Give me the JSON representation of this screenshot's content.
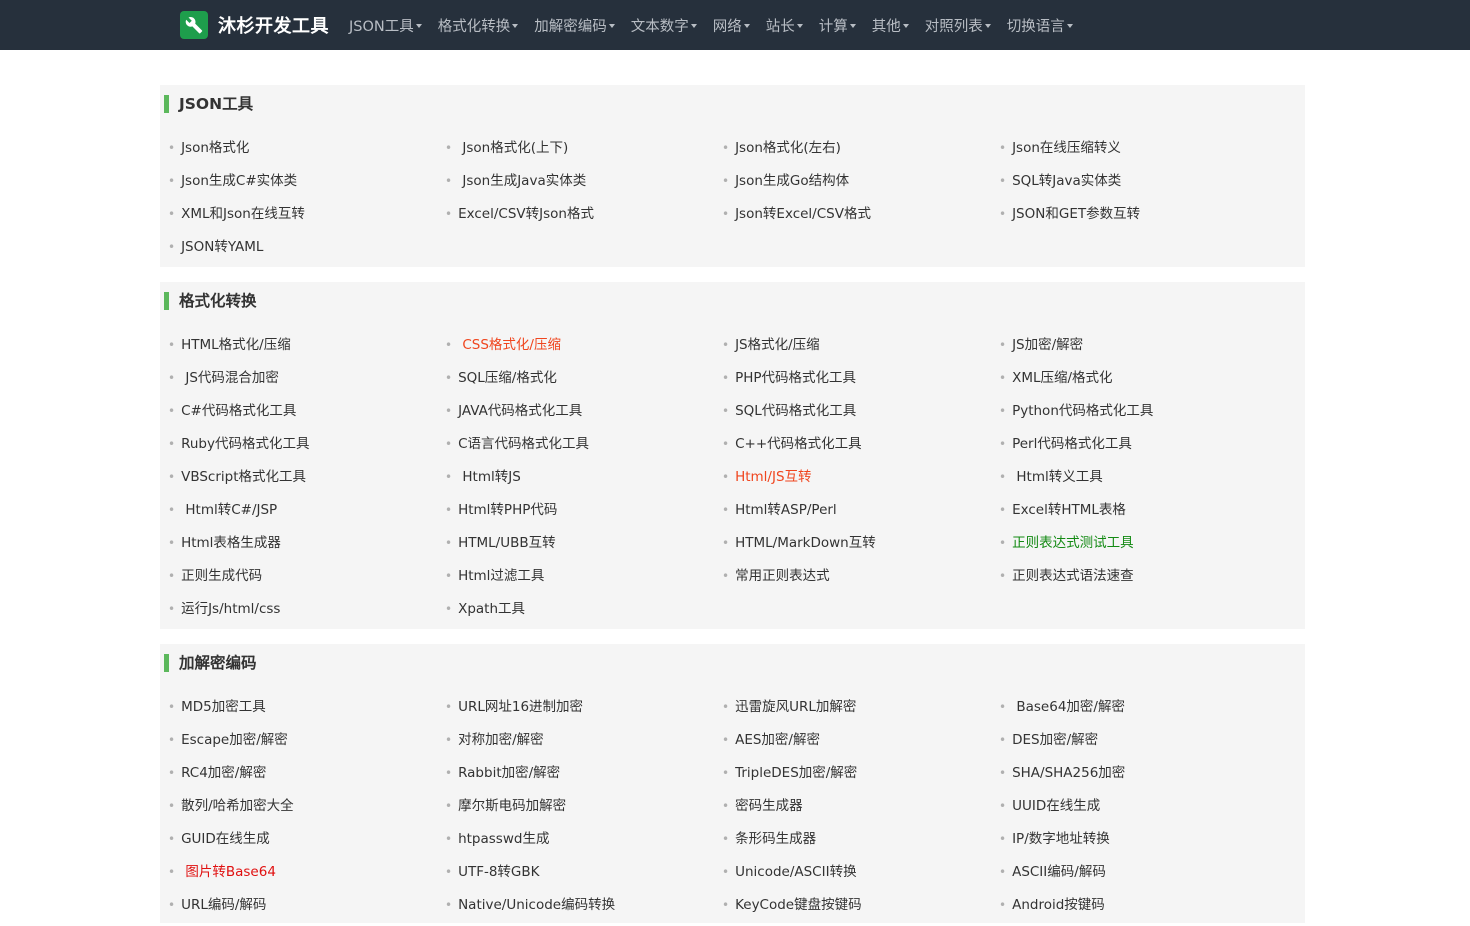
{
  "brand": {
    "name": "沐杉开发工具",
    "icon": "wrench-icon",
    "color": "#1e9e4c"
  },
  "nav": {
    "items": [
      "JSON工具",
      "格式化转换",
      "加解密编码",
      "文本数字",
      "网络",
      "站长",
      "计算",
      "其他",
      "对照列表",
      "切换语言"
    ]
  },
  "colors": {
    "navbar_bg": "#26303c",
    "section_bg": "#f5f5f5",
    "title_accent": "#5cb85c",
    "highlight_orange": "#f0451e",
    "highlight_red": "#e01010",
    "highlight_green": "#138a13"
  },
  "sections": [
    {
      "title": "JSON工具",
      "links": [
        {
          "label": "Json格式化"
        },
        {
          "label": " Json格式化(上下)"
        },
        {
          "label": "Json格式化(左右)"
        },
        {
          "label": "Json在线压缩转义"
        },
        {
          "label": "Json生成C#实体类"
        },
        {
          "label": " Json生成Java实体类"
        },
        {
          "label": "Json生成Go结构体"
        },
        {
          "label": "SQL转Java实体类"
        },
        {
          "label": "XML和Json在线互转"
        },
        {
          "label": "Excel/CSV转Json格式"
        },
        {
          "label": "Json转Excel/CSV格式"
        },
        {
          "label": "JSON和GET参数互转"
        },
        {
          "label": "JSON转YAML"
        }
      ]
    },
    {
      "title": "格式化转换",
      "links": [
        {
          "label": "HTML格式化/压缩"
        },
        {
          "label": " CSS格式化/压缩",
          "highlight": "orange"
        },
        {
          "label": "JS格式化/压缩"
        },
        {
          "label": "JS加密/解密"
        },
        {
          "label": " JS代码混合加密"
        },
        {
          "label": "SQL压缩/格式化"
        },
        {
          "label": "PHP代码格式化工具"
        },
        {
          "label": "XML压缩/格式化"
        },
        {
          "label": "C#代码格式化工具"
        },
        {
          "label": "JAVA代码格式化工具"
        },
        {
          "label": "SQL代码格式化工具"
        },
        {
          "label": "Python代码格式化工具"
        },
        {
          "label": "Ruby代码格式化工具"
        },
        {
          "label": "C语言代码格式化工具"
        },
        {
          "label": "C++代码格式化工具"
        },
        {
          "label": "Perl代码格式化工具"
        },
        {
          "label": "VBScript格式化工具"
        },
        {
          "label": " Html转JS"
        },
        {
          "label": "Html/JS互转",
          "highlight": "orange"
        },
        {
          "label": " Html转义工具"
        },
        {
          "label": " Html转C#/JSP"
        },
        {
          "label": "Html转PHP代码"
        },
        {
          "label": "Html转ASP/Perl"
        },
        {
          "label": "Excel转HTML表格"
        },
        {
          "label": "Html表格生成器"
        },
        {
          "label": "HTML/UBB互转"
        },
        {
          "label": "HTML/MarkDown互转"
        },
        {
          "label": "正则表达式测试工具",
          "highlight": "green"
        },
        {
          "label": "正则生成代码"
        },
        {
          "label": "Html过滤工具"
        },
        {
          "label": "常用正则表达式"
        },
        {
          "label": "正则表达式语法速查"
        },
        {
          "label": "运行Js/html/css"
        },
        {
          "label": "Xpath工具"
        }
      ]
    },
    {
      "title": "加解密编码",
      "links": [
        {
          "label": "MD5加密工具"
        },
        {
          "label": "URL网址16进制加密"
        },
        {
          "label": "迅雷旋风URL加解密"
        },
        {
          "label": " Base64加密/解密"
        },
        {
          "label": "Escape加密/解密"
        },
        {
          "label": "对称加密/解密"
        },
        {
          "label": "AES加密/解密"
        },
        {
          "label": "DES加密/解密"
        },
        {
          "label": "RC4加密/解密"
        },
        {
          "label": "Rabbit加密/解密"
        },
        {
          "label": "TripleDES加密/解密"
        },
        {
          "label": "SHA/SHA256加密"
        },
        {
          "label": "散列/哈希加密大全"
        },
        {
          "label": "摩尔斯电码加解密"
        },
        {
          "label": "密码生成器"
        },
        {
          "label": "UUID在线生成"
        },
        {
          "label": "GUID在线生成"
        },
        {
          "label": "htpasswd生成"
        },
        {
          "label": "条形码生成器"
        },
        {
          "label": "IP/数字地址转换"
        },
        {
          "label": " 图片转Base64",
          "highlight": "red"
        },
        {
          "label": "UTF-8转GBK"
        },
        {
          "label": "Unicode/ASCII转换"
        },
        {
          "label": "ASCII编码/解码"
        },
        {
          "label": "URL编码/解码"
        },
        {
          "label": "Native/Unicode编码转换"
        },
        {
          "label": "KeyCode键盘按键码"
        },
        {
          "label": "Android按键码"
        }
      ]
    }
  ]
}
